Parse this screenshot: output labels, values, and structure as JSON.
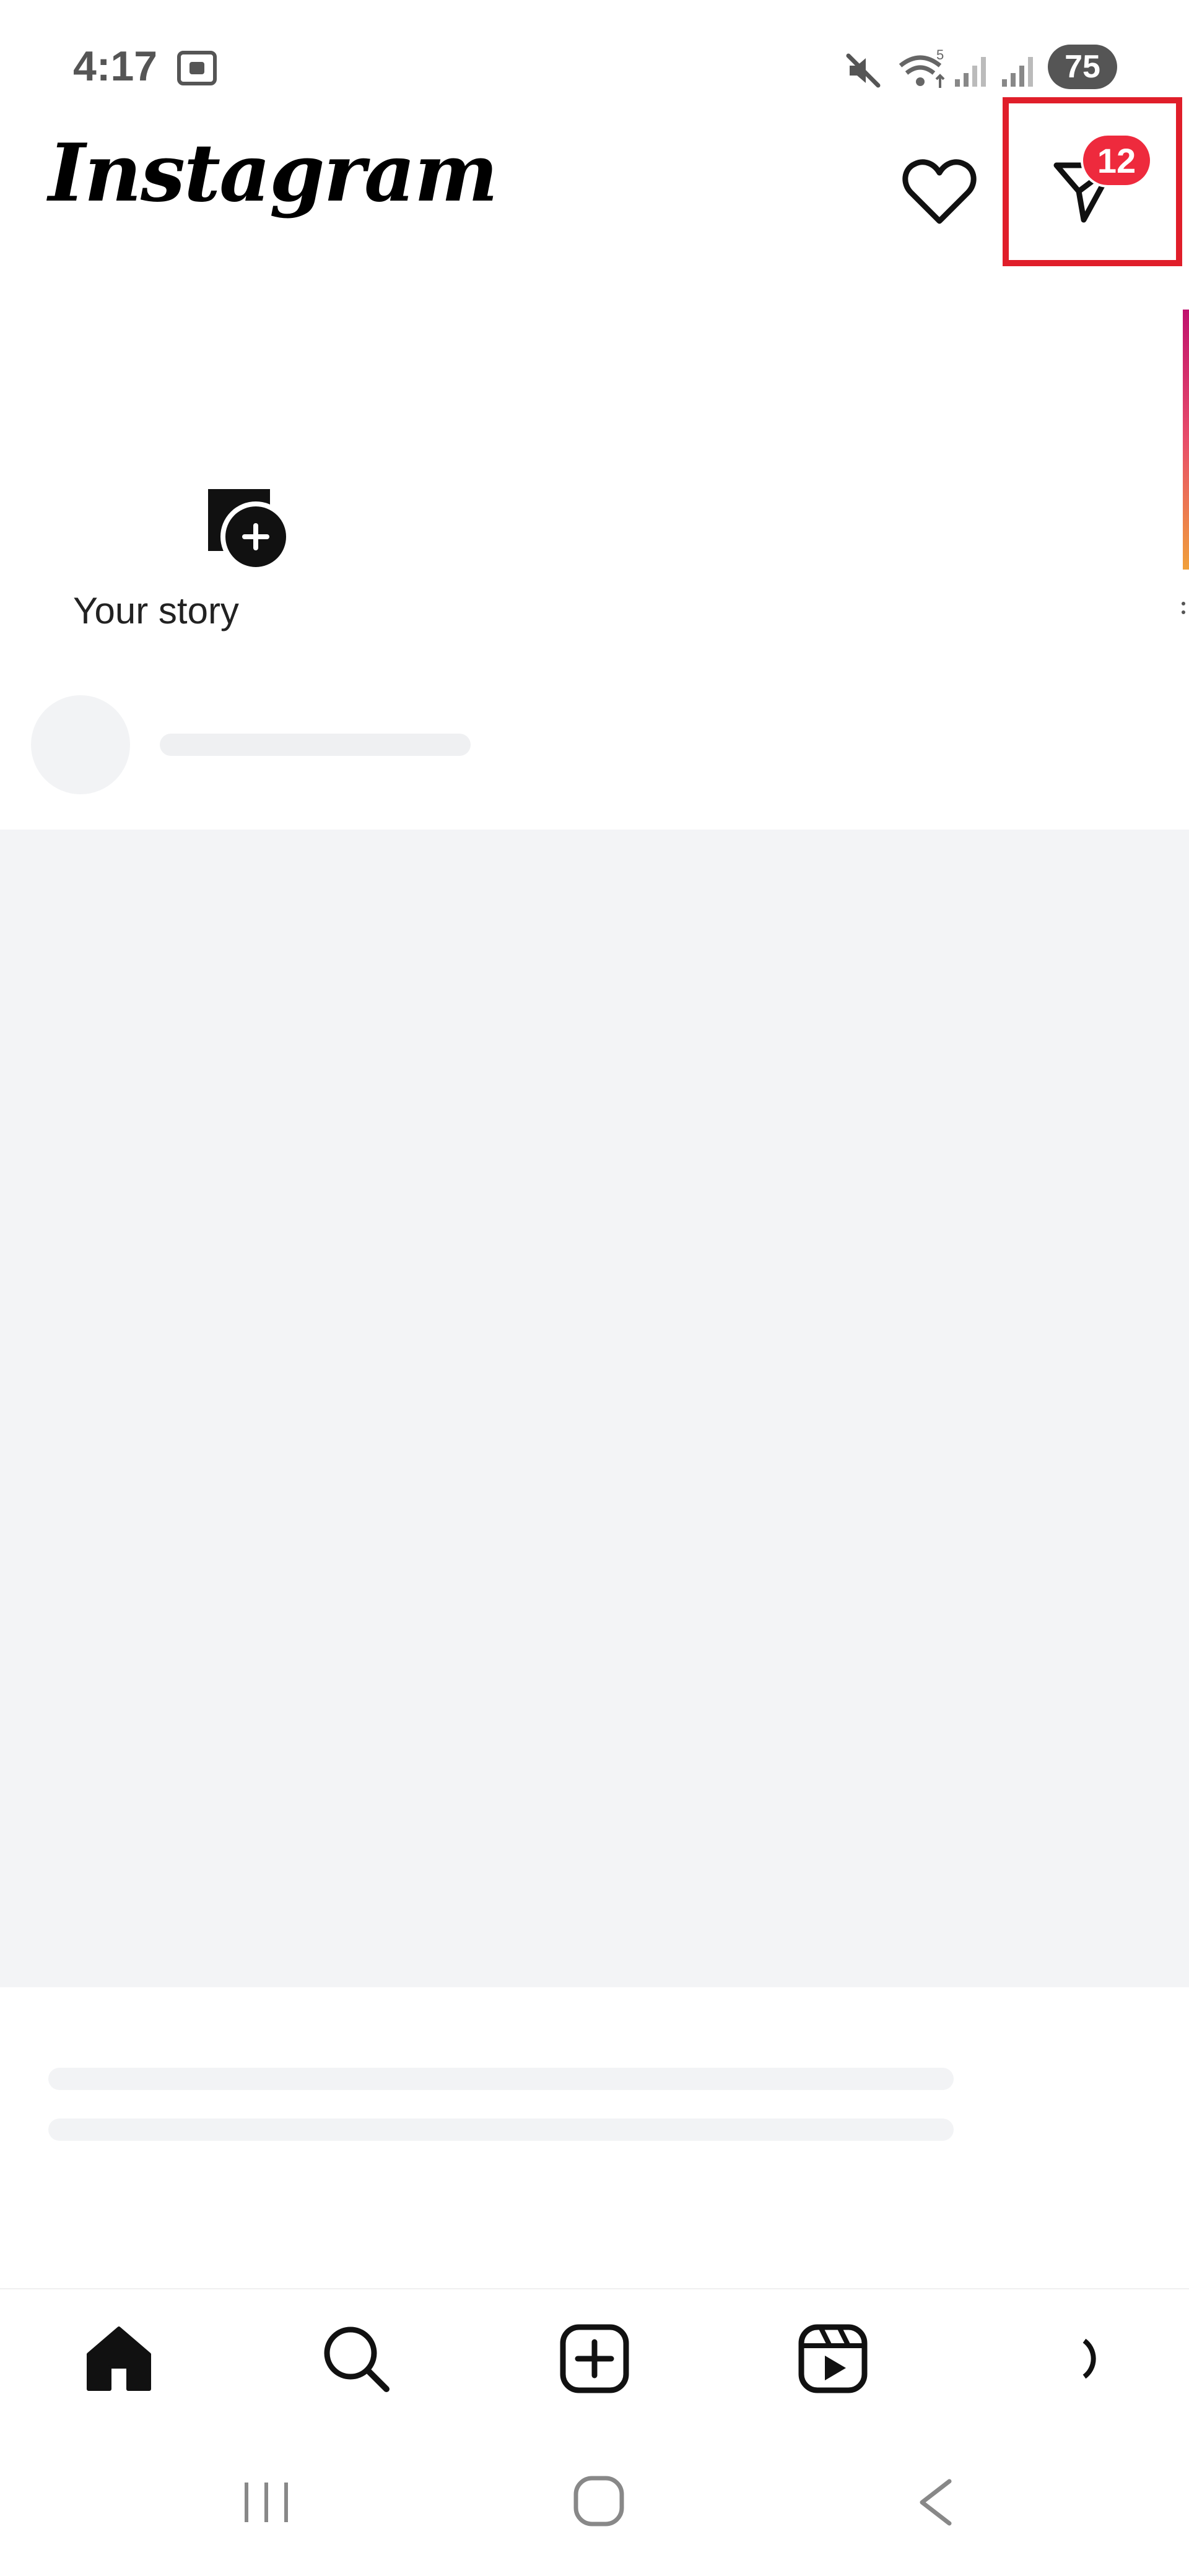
{
  "status_bar": {
    "time": "4:17",
    "battery": "75",
    "icons": [
      "screenshot-icon",
      "mute-icon",
      "wifi-icon",
      "signal-icon",
      "signal-icon",
      "battery-icon"
    ]
  },
  "header": {
    "logo_text": "Instagram",
    "icons": [
      "heart-icon",
      "direct-message-icon"
    ],
    "dm_badge_count": "12",
    "highlight_color": "#e01e2a",
    "badge_color": "#ee2a3d"
  },
  "stories": {
    "items": [
      {
        "label": "Your story",
        "icon": "add-story-icon"
      }
    ]
  },
  "feed": {
    "state": "loading-skeleton",
    "skeleton_color": "#f3f4f6"
  },
  "bottom_nav": {
    "items": [
      {
        "name": "home",
        "icon": "home-icon",
        "active": true
      },
      {
        "name": "search",
        "icon": "search-icon"
      },
      {
        "name": "create",
        "icon": "create-post-icon"
      },
      {
        "name": "reels",
        "icon": "reels-icon"
      },
      {
        "name": "profile",
        "icon": "profile-icon"
      }
    ]
  },
  "system_nav": {
    "icons": [
      "recent-apps-icon",
      "home-button-icon",
      "back-icon"
    ]
  }
}
